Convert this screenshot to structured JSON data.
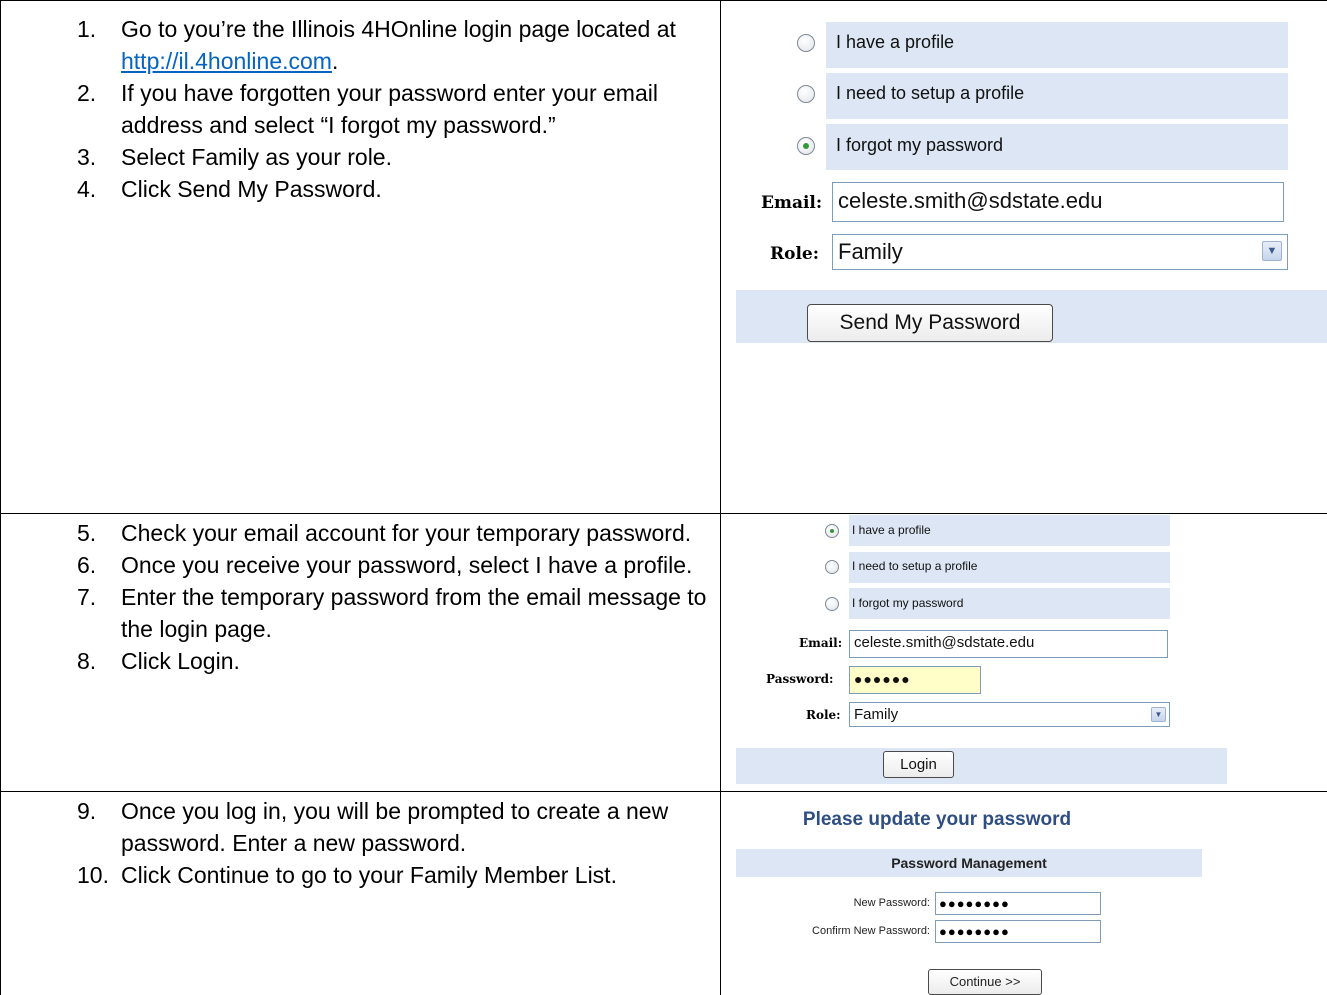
{
  "rows": [
    {
      "steps": [
        {
          "num": "1.",
          "text_before": "Go to you’re the Illinois 4HOnline login page located at ",
          "link": "http://il.4honline.com",
          "text_after": "."
        },
        {
          "num": "2.",
          "text": "If you have forgotten your password enter your email address and select “I forgot my password.”"
        },
        {
          "num": "3.",
          "text": "Select Family as your role."
        },
        {
          "num": "4.",
          "text": "Click Send My Password."
        }
      ],
      "screenshot": {
        "options": [
          {
            "label": "I have a profile",
            "selected": false
          },
          {
            "label": "I need to setup a profile",
            "selected": false
          },
          {
            "label": "I forgot my password",
            "selected": true
          }
        ],
        "email_label": "Email:",
        "email_value": "celeste.smith@sdstate.edu",
        "role_label": "Role:",
        "role_value": "Family",
        "button": "Send My Password"
      }
    },
    {
      "steps": [
        {
          "num": "5.",
          "text": "Check your email account for your temporary password."
        },
        {
          "num": "6.",
          "text": "Once you receive your password, select I have a profile."
        },
        {
          "num": "7.",
          "text": "Enter the temporary password from the email message to the login page."
        },
        {
          "num": "8.",
          "text": "Click Login."
        }
      ],
      "screenshot": {
        "options": [
          {
            "label": "I have a profile",
            "selected": true
          },
          {
            "label": "I need to setup a profile",
            "selected": false
          },
          {
            "label": "I forgot my password",
            "selected": false
          }
        ],
        "email_label": "Email:",
        "email_value": "celeste.smith@sdstate.edu",
        "password_label": "Password:",
        "password_value": "●●●●●●",
        "role_label": "Role:",
        "role_value": "Family",
        "button": "Login"
      }
    },
    {
      "steps": [
        {
          "num": "9.",
          "text": "Once you log in, you will be prompted to create a new password. Enter a new password."
        },
        {
          "num": "10.",
          "text": "Click Continue to go to your Family Member List."
        }
      ],
      "screenshot": {
        "title": "Please update your password",
        "section": "Password Management",
        "new_password_label": "New Password:",
        "new_password_value": "●●●●●●●●",
        "confirm_password_label": "Confirm New Password:",
        "confirm_password_value": "●●●●●●●●",
        "button": "Continue >>"
      }
    }
  ],
  "colors": {
    "bar": "#dce6f4",
    "link": "#0563c1",
    "title": "#2e4e84",
    "radio_selected": "#2f9a37",
    "password_field": "#fffdc8"
  }
}
